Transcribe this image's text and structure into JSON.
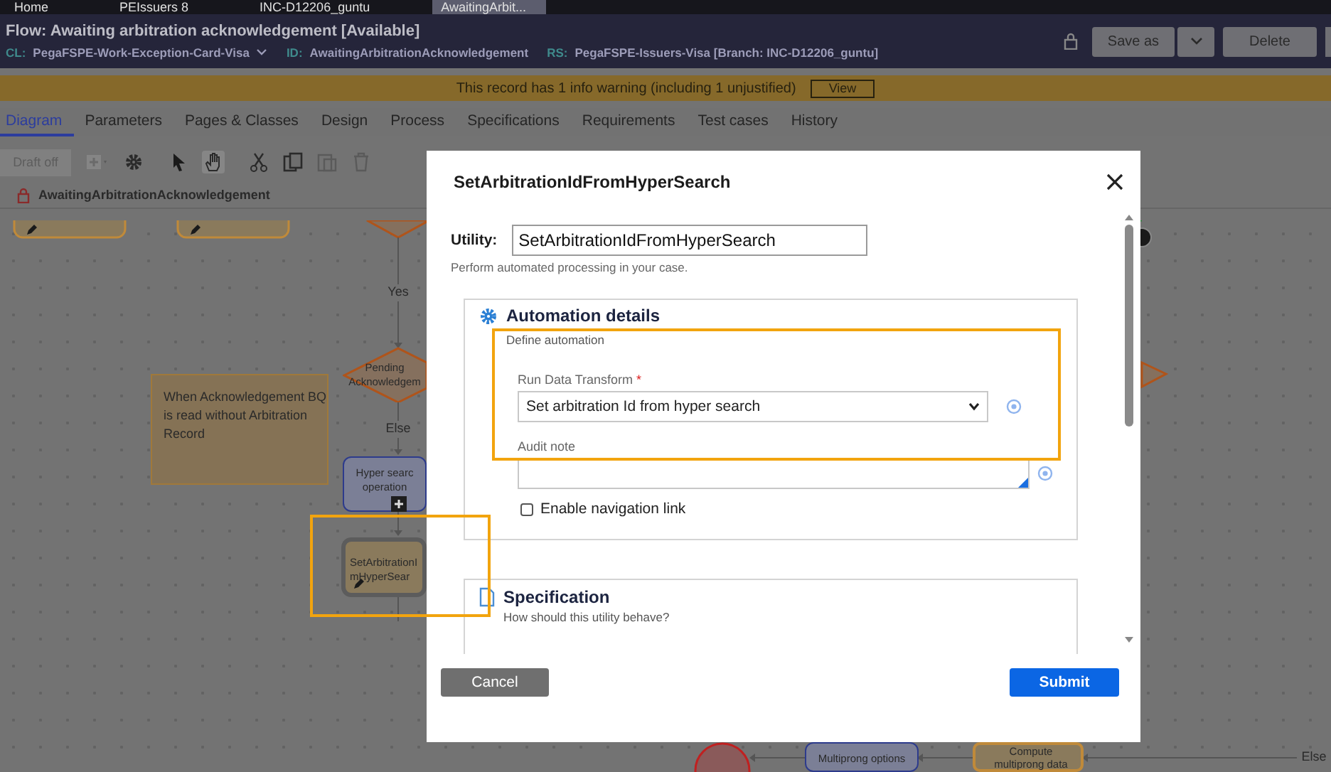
{
  "app_tabs": [
    {
      "label": "Home",
      "selected": false
    },
    {
      "label": "PEIssuers 8",
      "selected": false
    },
    {
      "label": "INC-D12206_guntu",
      "selected": false
    },
    {
      "label": "AwaitingArbit...",
      "selected": true
    }
  ],
  "header": {
    "title": "Flow: Awaiting arbitration acknowledgement [Available]",
    "class_label": "CL:",
    "class_value": "PegaFSPE-Work-Exception-Card-Visa",
    "id_label": "ID:",
    "id_value": "AwaitingArbitrationAcknowledgement",
    "rs_label": "RS:",
    "rs_value": "PegaFSPE-Issuers-Visa [Branch: INC-D12206_guntu]",
    "save_button": "Save as",
    "delete_button": "Delete"
  },
  "warning": {
    "text": "This record has 1 info warning (including 1 unjustified)",
    "button": "View"
  },
  "tabs": [
    {
      "label": "Diagram",
      "selected": true
    },
    {
      "label": "Parameters",
      "selected": false
    },
    {
      "label": "Pages & Classes",
      "selected": false
    },
    {
      "label": "Design",
      "selected": false
    },
    {
      "label": "Process",
      "selected": false
    },
    {
      "label": "Specifications",
      "selected": false
    },
    {
      "label": "Requirements",
      "selected": false
    },
    {
      "label": "Test cases",
      "selected": false
    },
    {
      "label": "History",
      "selected": false
    }
  ],
  "toolbar": {
    "draft_button": "Draft off"
  },
  "breadcrumb": "AwaitingArbitrationAcknowledgement",
  "diagram": {
    "nodes": [
      {
        "kind": "connector-label",
        "lines": [
          "Yes"
        ]
      },
      {
        "kind": "decision",
        "lines": [
          "Pending",
          "Acknowledgem"
        ]
      },
      {
        "kind": "note",
        "lines": [
          "When Acknowledgement BQ is",
          "read without Arbitration",
          "Record"
        ]
      },
      {
        "kind": "connector-label",
        "lines": [
          "Else"
        ]
      },
      {
        "kind": "subprocess",
        "lines": [
          "Hyper searc",
          "operation"
        ]
      },
      {
        "kind": "utility",
        "lines": [
          "SetArbitrationI",
          "mHyperSear"
        ]
      },
      {
        "kind": "subprocess",
        "lines": [
          "Multiprong options"
        ]
      },
      {
        "kind": "utility",
        "lines": [
          "Compute",
          "multiprong data"
        ]
      },
      {
        "kind": "connector-label",
        "lines": [
          "Else"
        ]
      }
    ]
  },
  "dialog": {
    "title": "SetArbitrationIdFromHyperSearch",
    "utility_label": "Utility:",
    "utility_value": "SetArbitrationIdFromHyperSearch",
    "hint": "Perform automated processing in your case.",
    "automation": {
      "title": "Automation details",
      "subtitle": "Define automation",
      "transform_label": "Run Data Transform",
      "required_marker": "*",
      "transform_value": "Set arbitration Id from hyper search",
      "audit_label": "Audit note",
      "nav_link": {
        "label": "Enable navigation link",
        "checked": false
      }
    },
    "specification": {
      "title": "Specification",
      "subtitle": "How should this utility behave?"
    },
    "cancel_button": "Cancel",
    "submit_button": "Submit"
  }
}
